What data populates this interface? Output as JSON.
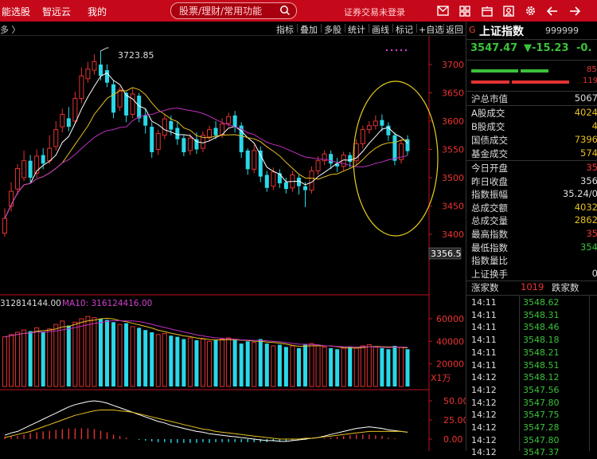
{
  "topbar": {
    "nav": [
      "能选股",
      "智远云",
      "我的"
    ],
    "search_placeholder": "股票/理财/常用功能",
    "status": "证券交易未登录",
    "icons": [
      "mail-icon",
      "grid-icon",
      "box-icon",
      "user-icon",
      "settings-icon",
      "back-arrow-icon",
      "forward-arrow-icon"
    ]
  },
  "toolbar": {
    "crumb": "多 〉",
    "buttons": [
      "指标",
      "叠加",
      "多股",
      "统计",
      "画线",
      "标记",
      "+自选",
      "返回"
    ]
  },
  "chart": {
    "high_label": "3723.85",
    "cursor_label": "3356.5",
    "price_ticks": [
      "3700",
      "3650",
      "3600",
      "3550",
      "3500",
      "3450",
      "3400"
    ],
    "vol_ticks": [
      "60000",
      "40000",
      "20000"
    ],
    "vol_unit": "X1万",
    "vol_label1": "312814144.00",
    "vol_label2": "MA10: 316124416.00",
    "macd_ticks": [
      "50.00",
      "25.00",
      "0.00"
    ],
    "colors": {
      "up": "#e33333",
      "down": "#2ad8e8",
      "ma5": "#ffffff",
      "ma10": "#e8c020",
      "ma20": "#c030c0"
    }
  },
  "chart_data": {
    "type": "candlestick",
    "ylim": [
      3356.5,
      3723.85
    ],
    "price_ticks": [
      3700,
      3650,
      3600,
      3550,
      3500,
      3450,
      3400
    ],
    "volume_ticks": [
      60000,
      40000,
      20000
    ],
    "volume_unit": "X1万",
    "volume_ma_label": "312814144.00",
    "volume_ma10": 316124416.0,
    "macd_ticks": [
      50.0,
      25.0,
      0.0
    ],
    "high": 3723.85,
    "cursor_value": 3356.5,
    "candles": [
      {
        "o": 3402,
        "c": 3428,
        "h": 3446,
        "l": 3396
      },
      {
        "o": 3450,
        "c": 3476,
        "h": 3492,
        "l": 3440
      },
      {
        "o": 3480,
        "c": 3516,
        "h": 3524,
        "l": 3470
      },
      {
        "o": 3500,
        "c": 3530,
        "h": 3548,
        "l": 3494
      },
      {
        "o": 3530,
        "c": 3500,
        "h": 3540,
        "l": 3492
      },
      {
        "o": 3508,
        "c": 3538,
        "h": 3550,
        "l": 3500
      },
      {
        "o": 3540,
        "c": 3525,
        "h": 3552,
        "l": 3515
      },
      {
        "o": 3530,
        "c": 3552,
        "h": 3575,
        "l": 3524
      },
      {
        "o": 3555,
        "c": 3585,
        "h": 3600,
        "l": 3548
      },
      {
        "o": 3590,
        "c": 3612,
        "h": 3622,
        "l": 3580
      },
      {
        "o": 3605,
        "c": 3590,
        "h": 3625,
        "l": 3582
      },
      {
        "o": 3600,
        "c": 3640,
        "h": 3652,
        "l": 3595
      },
      {
        "o": 3640,
        "c": 3680,
        "h": 3695,
        "l": 3632
      },
      {
        "o": 3675,
        "c": 3692,
        "h": 3705,
        "l": 3668
      },
      {
        "o": 3690,
        "c": 3705,
        "h": 3718,
        "l": 3682
      },
      {
        "o": 3700,
        "c": 3680,
        "h": 3724,
        "l": 3672
      },
      {
        "o": 3690,
        "c": 3668,
        "h": 3700,
        "l": 3660
      },
      {
        "o": 3665,
        "c": 3615,
        "h": 3672,
        "l": 3605
      },
      {
        "o": 3625,
        "c": 3655,
        "h": 3660,
        "l": 3618
      },
      {
        "o": 3650,
        "c": 3610,
        "h": 3652,
        "l": 3598
      },
      {
        "o": 3612,
        "c": 3648,
        "h": 3658,
        "l": 3605
      },
      {
        "o": 3645,
        "c": 3605,
        "h": 3650,
        "l": 3598
      },
      {
        "o": 3610,
        "c": 3592,
        "h": 3622,
        "l": 3578
      },
      {
        "o": 3590,
        "c": 3545,
        "h": 3598,
        "l": 3535
      },
      {
        "o": 3550,
        "c": 3578,
        "h": 3585,
        "l": 3540
      },
      {
        "o": 3575,
        "c": 3604,
        "h": 3612,
        "l": 3568
      },
      {
        "o": 3600,
        "c": 3585,
        "h": 3610,
        "l": 3575
      },
      {
        "o": 3588,
        "c": 3568,
        "h": 3600,
        "l": 3558
      },
      {
        "o": 3570,
        "c": 3545,
        "h": 3575,
        "l": 3538
      },
      {
        "o": 3548,
        "c": 3570,
        "h": 3578,
        "l": 3540
      },
      {
        "o": 3568,
        "c": 3550,
        "h": 3580,
        "l": 3542
      },
      {
        "o": 3552,
        "c": 3575,
        "h": 3582,
        "l": 3545
      },
      {
        "o": 3572,
        "c": 3585,
        "h": 3592,
        "l": 3565
      },
      {
        "o": 3588,
        "c": 3575,
        "h": 3600,
        "l": 3568
      },
      {
        "o": 3576,
        "c": 3595,
        "h": 3605,
        "l": 3570
      },
      {
        "o": 3596,
        "c": 3608,
        "h": 3615,
        "l": 3590
      },
      {
        "o": 3610,
        "c": 3590,
        "h": 3618,
        "l": 3580
      },
      {
        "o": 3592,
        "c": 3545,
        "h": 3598,
        "l": 3535
      },
      {
        "o": 3548,
        "c": 3515,
        "h": 3552,
        "l": 3505
      },
      {
        "o": 3515,
        "c": 3548,
        "h": 3558,
        "l": 3508
      },
      {
        "o": 3548,
        "c": 3502,
        "h": 3555,
        "l": 3492
      },
      {
        "o": 3505,
        "c": 3482,
        "h": 3512,
        "l": 3475
      },
      {
        "o": 3485,
        "c": 3510,
        "h": 3518,
        "l": 3478
      },
      {
        "o": 3508,
        "c": 3490,
        "h": 3515,
        "l": 3482
      },
      {
        "o": 3492,
        "c": 3480,
        "h": 3500,
        "l": 3472
      },
      {
        "o": 3482,
        "c": 3505,
        "h": 3512,
        "l": 3475
      },
      {
        "o": 3500,
        "c": 3485,
        "h": 3505,
        "l": 3470
      },
      {
        "o": 3485,
        "c": 3478,
        "h": 3492,
        "l": 3448
      },
      {
        "o": 3478,
        "c": 3512,
        "h": 3520,
        "l": 3472
      },
      {
        "o": 3512,
        "c": 3530,
        "h": 3538,
        "l": 3505
      },
      {
        "o": 3530,
        "c": 3542,
        "h": 3548,
        "l": 3522
      },
      {
        "o": 3542,
        "c": 3525,
        "h": 3548,
        "l": 3515
      },
      {
        "o": 3525,
        "c": 3520,
        "h": 3535,
        "l": 3510
      },
      {
        "o": 3520,
        "c": 3540,
        "h": 3546,
        "l": 3512
      },
      {
        "o": 3540,
        "c": 3528,
        "h": 3545,
        "l": 3518
      },
      {
        "o": 3530,
        "c": 3560,
        "h": 3568,
        "l": 3522
      },
      {
        "o": 3560,
        "c": 3585,
        "h": 3592,
        "l": 3552
      },
      {
        "o": 3585,
        "c": 3592,
        "h": 3600,
        "l": 3578
      },
      {
        "o": 3592,
        "c": 3600,
        "h": 3610,
        "l": 3585
      },
      {
        "o": 3602,
        "c": 3592,
        "h": 3612,
        "l": 3582
      },
      {
        "o": 3592,
        "c": 3575,
        "h": 3598,
        "l": 3565
      },
      {
        "o": 3575,
        "c": 3530,
        "h": 3580,
        "l": 3522
      },
      {
        "o": 3532,
        "c": 3560,
        "h": 3568,
        "l": 3525
      },
      {
        "o": 3568,
        "c": 3547,
        "h": 3575,
        "l": 3540
      }
    ],
    "volumes": [
      44000,
      46000,
      48000,
      50000,
      49000,
      52000,
      48000,
      51000,
      55000,
      58000,
      54000,
      57000,
      60000,
      62000,
      61000,
      60000,
      59000,
      57000,
      55000,
      56000,
      53000,
      52000,
      50000,
      48000,
      46000,
      47000,
      45000,
      44000,
      42000,
      43000,
      41000,
      42000,
      40000,
      41000,
      42000,
      43000,
      41000,
      38000,
      40000,
      39000,
      42000,
      38000,
      36000,
      37000,
      35000,
      36000,
      34000,
      37000,
      38000,
      36000,
      35000,
      34000,
      33000,
      34000,
      35000,
      34000,
      36000,
      37000,
      35000,
      34000,
      33000,
      36000,
      35000,
      33000
    ],
    "macd_dif": [
      5,
      8,
      10,
      14,
      18,
      22,
      26,
      30,
      34,
      38,
      42,
      45,
      47,
      49,
      50,
      49,
      47,
      44,
      41,
      38,
      35,
      32,
      29,
      26,
      23,
      21,
      18,
      16,
      14,
      12,
      10,
      9,
      7,
      6,
      5,
      4,
      3,
      2,
      1,
      0,
      -1,
      -2,
      -2,
      -3,
      -3,
      -2,
      -1,
      0,
      1,
      2,
      4,
      6,
      8,
      10,
      12,
      14,
      15,
      16,
      15,
      14,
      12,
      11,
      10,
      9
    ],
    "macd_dea": [
      2,
      4,
      6,
      8,
      10,
      13,
      16,
      19,
      22,
      25,
      28,
      31,
      33,
      35,
      37,
      38,
      38,
      38,
      37,
      36,
      35,
      33,
      31,
      29,
      27,
      25,
      23,
      21,
      19,
      17,
      15,
      13,
      12,
      10,
      9,
      8,
      7,
      6,
      5,
      4,
      3,
      2,
      1,
      0,
      0,
      0,
      0,
      1,
      1,
      2,
      3,
      4,
      5,
      6,
      7,
      8,
      9,
      10,
      10,
      10,
      10,
      10,
      10,
      9
    ],
    "macd_hist": [
      3,
      4,
      4,
      6,
      8,
      9,
      10,
      11,
      12,
      13,
      14,
      14,
      14,
      14,
      13,
      11,
      9,
      6,
      4,
      2,
      0,
      -1,
      -2,
      -3,
      -4,
      -4,
      -5,
      -5,
      -5,
      -5,
      -5,
      -4,
      -5,
      -4,
      -4,
      -4,
      -4,
      -4,
      -4,
      -4,
      -4,
      -4,
      -3,
      -3,
      -3,
      -2,
      -1,
      -1,
      0,
      0,
      1,
      2,
      3,
      4,
      5,
      6,
      6,
      6,
      5,
      4,
      2,
      1,
      0,
      0
    ]
  },
  "right": {
    "gmark": "G",
    "index_name": "上证指数",
    "index_code": "999999",
    "price": "3547.47",
    "change": "▼-15.23",
    "pct": "-0.",
    "up_count": "85",
    "down_count": "119",
    "market_cap_label": "沪总市值",
    "market_cap_value": "5067",
    "rows1": [
      {
        "k": "A股成交",
        "v": "4024"
      },
      {
        "k": "B股成交",
        "v": "4"
      },
      {
        "k": "国债成交",
        "v": "7396"
      },
      {
        "k": "基金成交",
        "v": "574"
      }
    ],
    "rows2": [
      {
        "k": "今日开盘",
        "v": "35"
      },
      {
        "k": "昨日收盘",
        "v": "356"
      },
      {
        "k": "指数振幅",
        "v": "35.24/0"
      },
      {
        "k": "总成交额",
        "v": "4032"
      },
      {
        "k": "总成交量",
        "v": "2862"
      },
      {
        "k": "最高指数",
        "v": "35"
      },
      {
        "k": "最低指数",
        "v": "354"
      },
      {
        "k": "指数量比",
        "v": ""
      },
      {
        "k": "上证换手",
        "v": "0"
      }
    ],
    "up_label": "涨家数",
    "up_num": "1019",
    "down_label": "跌家数",
    "ticks": [
      {
        "t": "14:11",
        "p": "3548.62"
      },
      {
        "t": "14:11",
        "p": "3548.31"
      },
      {
        "t": "14:11",
        "p": "3548.46"
      },
      {
        "t": "14:11",
        "p": "3548.18"
      },
      {
        "t": "14:11",
        "p": "3548.21"
      },
      {
        "t": "14:11",
        "p": "3548.51"
      },
      {
        "t": "14:12",
        "p": "3548.12"
      },
      {
        "t": "14:12",
        "p": "3547.56"
      },
      {
        "t": "14:12",
        "p": "3547.80"
      },
      {
        "t": "14:12",
        "p": "3547.75"
      },
      {
        "t": "14:12",
        "p": "3547.28"
      },
      {
        "t": "14:12",
        "p": "3547.80"
      },
      {
        "t": "14:12",
        "p": "3547.37"
      }
    ]
  }
}
